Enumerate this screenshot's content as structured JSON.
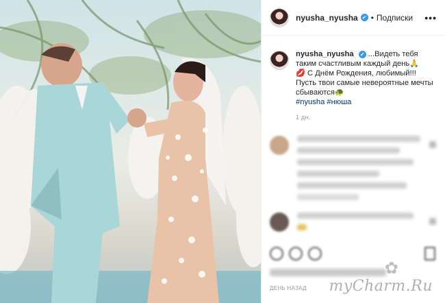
{
  "post": {
    "username": "nyusha_nyusha",
    "verified_glyph": "✔",
    "separator": "•",
    "follow_label": "Подписки",
    "more_label": "•••",
    "caption_username": "nyusha_nyusha",
    "caption_line1": "...Видеть тебя таким счастливым каждый день🙏",
    "caption_line2": "💋 С Днём Рождения, любимый!!!",
    "caption_line3": "Пусть твои самые невероятные мечты сбываются🐢",
    "hashtags": "#nyusha #нюша",
    "posted_ago": "1 дн.",
    "footer_time": "ДЕНЬ НАЗАД"
  },
  "icons": {
    "verified": "verified-badge-icon",
    "more": "more-options-icon",
    "like": "heart-icon",
    "comment": "comment-icon",
    "share": "share-icon",
    "save": "bookmark-icon"
  },
  "watermark": {
    "text": "myCharm.Ru",
    "flower": "✿"
  },
  "colors": {
    "link": "#003569",
    "verified": "#3897f0",
    "muted": "#999999",
    "suit": "#a9d6d6",
    "dress": "#e8c3a8"
  }
}
